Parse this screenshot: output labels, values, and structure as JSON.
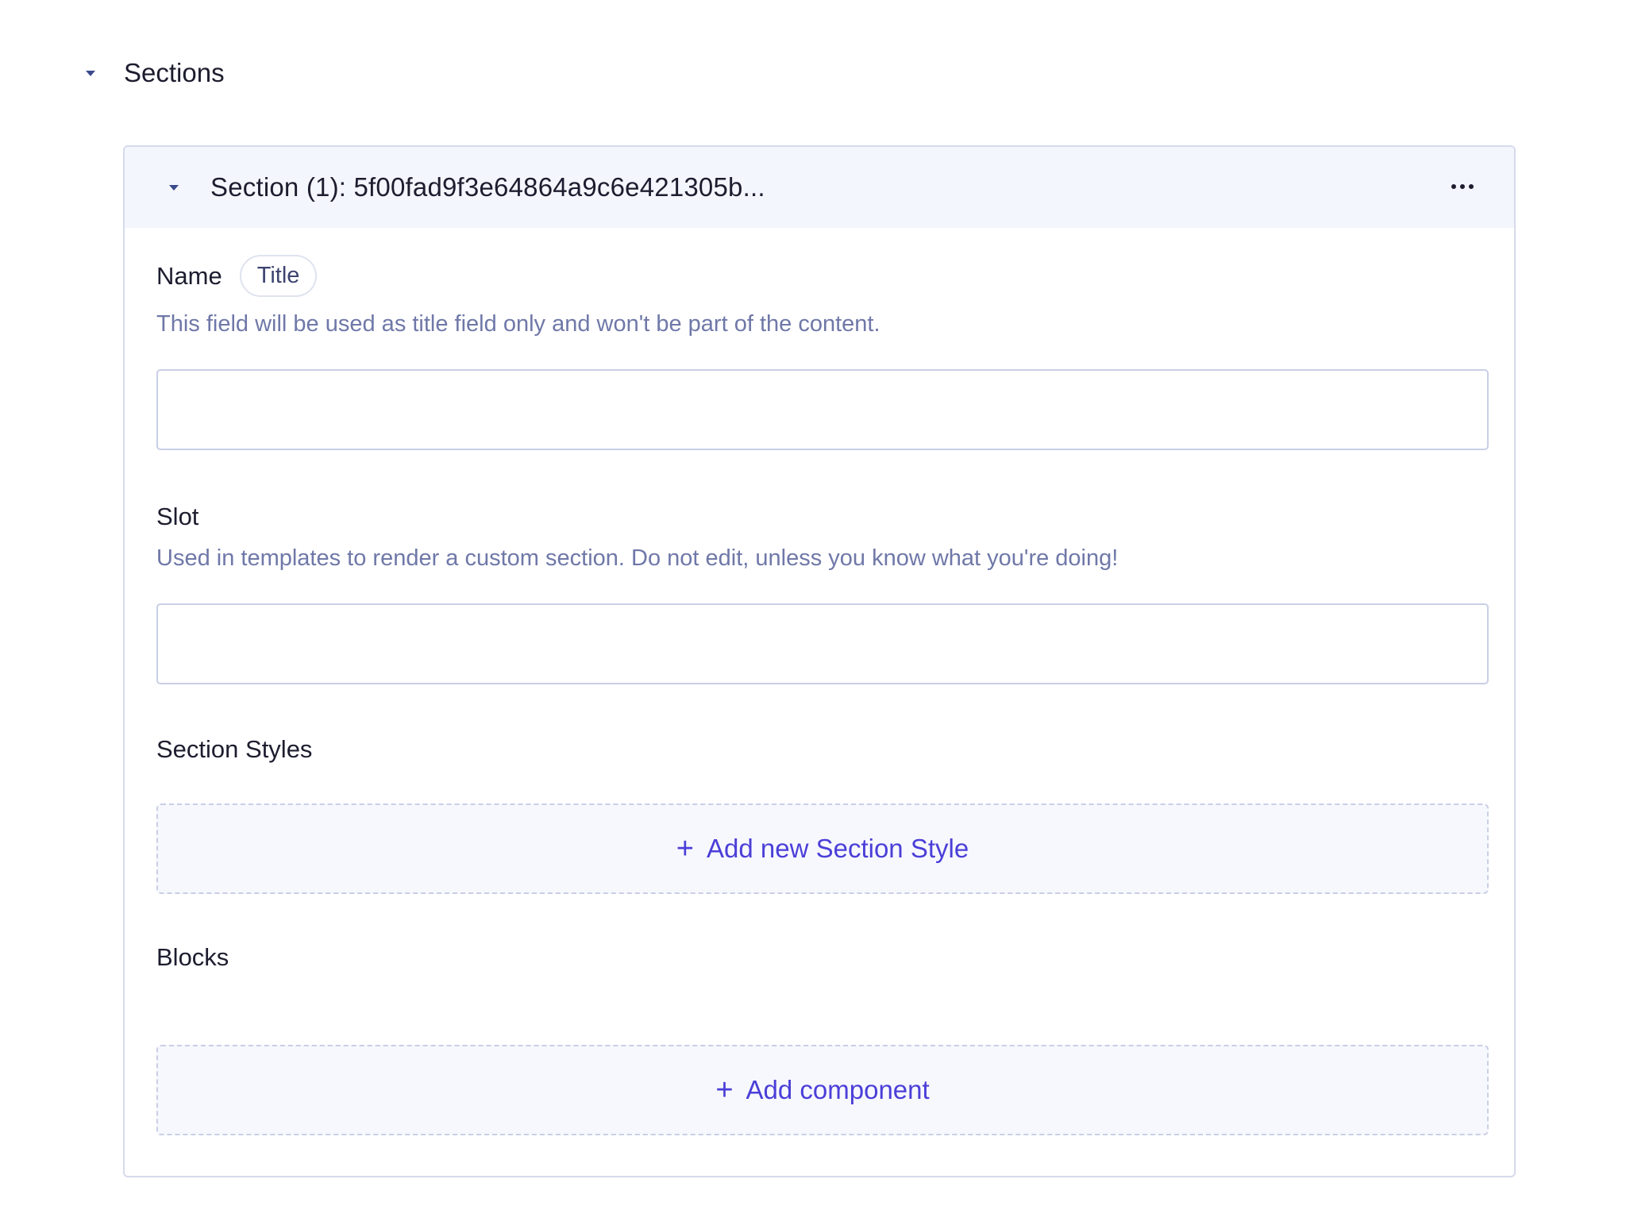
{
  "sections_panel": {
    "title": "Sections"
  },
  "section_card": {
    "title": "Section (1): 5f00fad9f3e64864a9c6e421305b...",
    "more_icon": "more-horizontal-icon",
    "fields": {
      "name": {
        "label": "Name",
        "badge": "Title",
        "help": "This field will be used as title field only and won't be part of the content.",
        "value": ""
      },
      "slot": {
        "label": "Slot",
        "help": "Used in templates to render a custom section. Do not edit, unless you know what you're doing!",
        "value": ""
      },
      "section_styles": {
        "label": "Section Styles",
        "add_label": "Add new Section Style"
      },
      "blocks": {
        "label": "Blocks",
        "add_label": "Add component"
      }
    }
  },
  "colors": {
    "accent": "#4b3fd8",
    "help_text": "#6f78a8",
    "header_bg": "#f4f6fd",
    "border": "#d6dbec"
  }
}
